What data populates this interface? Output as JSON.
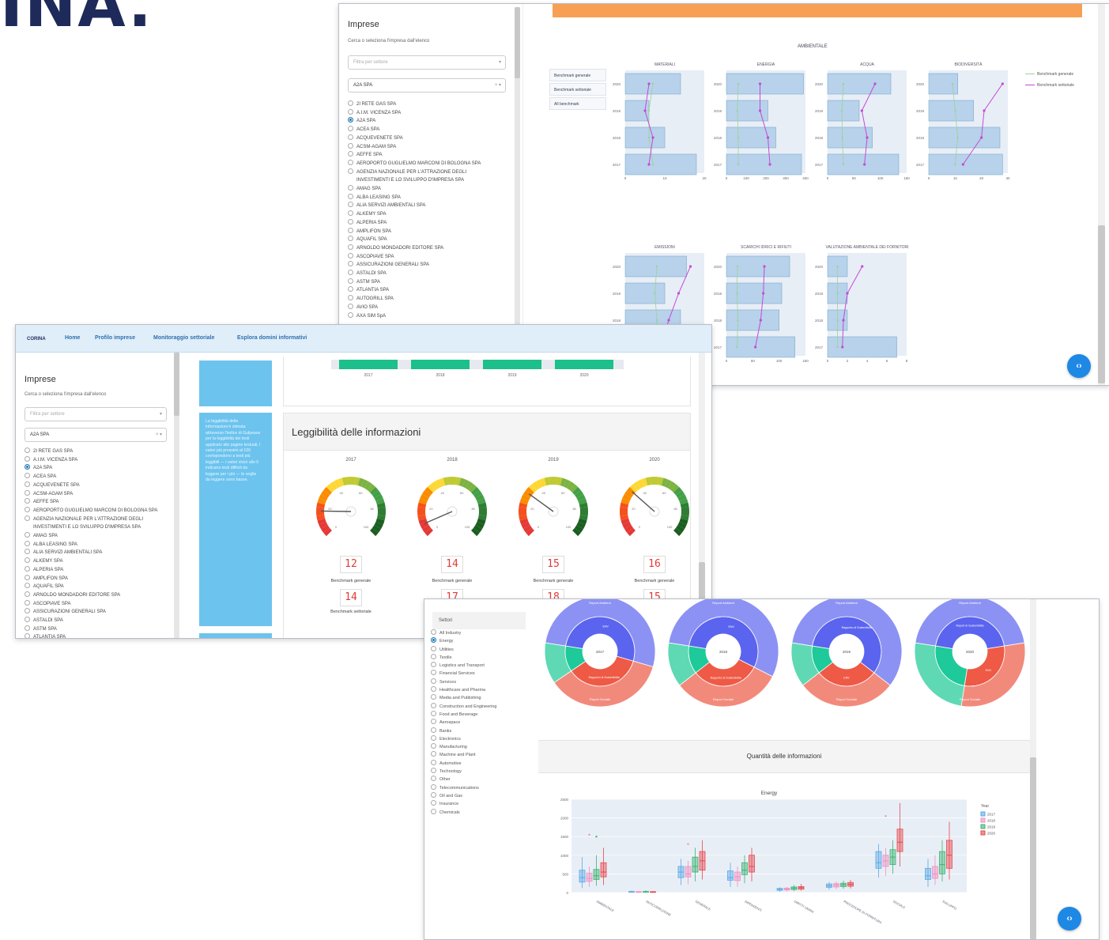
{
  "logo_text": "INA.",
  "shot1": {
    "sidebar": {
      "title": "Imprese",
      "subtitle": "Cerca o seleziona l'impresa dall'elenco",
      "filter_placeholder": "Filtra per settore",
      "selected": "A2A SPA",
      "companies": [
        "2I RETE GAS SPA",
        "A.I.M. VICENZA SPA",
        "A2A SPA",
        "ACEA SPA",
        "ACQUEVENETE SPA",
        "ACSM-AGAM SPA",
        "AEFFE SPA",
        "AEROPORTO GUGLIELMO MARCONI DI BOLOGNA SPA",
        "AGENZIA NAZIONALE PER L'ATTRAZIONE DEGLI",
        "INVESTIMENTI E LO SVILUPPO D'IMPRESA SPA",
        "AMAG SPA",
        "ALBA LEASING SPA",
        "ALIA SERVIZI AMBIENTALI SPA",
        "ALKEMY SPA",
        "ALPERIA SPA",
        "AMPLIFON SPA",
        "AQUAFIL SPA",
        "ARNOLDO MONDADORI EDITORE SPA",
        "ASCOPIAVE SPA",
        "ASSICURAZIONI GENERALI SPA",
        "ASTALDI SPA",
        "ASTM SPA",
        "ATLANTIA SPA",
        "AUTOGRILL SPA",
        "AVIO SPA",
        "AXA SIM SpA"
      ]
    },
    "benchmark_buttons": [
      "Benchmark generale",
      "Benchmark settoriale",
      "All benchmark"
    ],
    "section_title": "AMBIENTALE",
    "legend": [
      "Benchmark generale",
      "Benchmark settoriale"
    ],
    "years": [
      "2017",
      "2018",
      "2019",
      "2020"
    ],
    "top_orange_bar_color": "#f7a055",
    "panels_row1": [
      {
        "title": "MATERIALI",
        "ticks": [
          "0",
          "10",
          "20"
        ],
        "xmax": 20,
        "bars": [
          18,
          10,
          6,
          14
        ],
        "gen": [
          7,
          6,
          6,
          7
        ],
        "sect": [
          6,
          7,
          5,
          6
        ]
      },
      {
        "title": "ENERGIA",
        "ticks": [
          "0",
          "100",
          "200",
          "300",
          "400"
        ],
        "xmax": 400,
        "bars": [
          380,
          250,
          210,
          390
        ],
        "gen": [
          60,
          60,
          55,
          60
        ],
        "sect": [
          220,
          210,
          170,
          170
        ]
      },
      {
        "title": "ACQUA",
        "ticks": [
          "0",
          "50",
          "100",
          "150"
        ],
        "xmax": 150,
        "bars": [
          135,
          85,
          60,
          120
        ],
        "gen": [
          30,
          28,
          27,
          30
        ],
        "sect": [
          70,
          75,
          65,
          90
        ]
      },
      {
        "title": "BIODIVERSITÀ",
        "ticks": [
          "0",
          "10",
          "20",
          "30"
        ],
        "xmax": 30,
        "bars": [
          28,
          27,
          17,
          11
        ],
        "gen": [
          10,
          11,
          10,
          9
        ],
        "sect": [
          13,
          20,
          21,
          28
        ]
      }
    ],
    "panels_row2": [
      {
        "title": "EMISSIONI",
        "ticks": [
          "0",
          "20",
          "40"
        ],
        "xmax": 40,
        "bars": [
          35,
          28,
          20,
          31
        ],
        "gen": [
          15,
          16,
          15,
          16
        ],
        "sect": [
          18,
          22,
          27,
          33
        ]
      },
      {
        "title": "SCARICHI IDRICI E RIFIUTI",
        "ticks": [
          "0",
          "50",
          "100",
          "150"
        ],
        "xmax": 150,
        "bars": [
          130,
          100,
          105,
          120
        ],
        "gen": [
          20,
          22,
          20,
          21
        ],
        "sect": [
          55,
          65,
          70,
          72
        ]
      },
      {
        "title": "VALUTAZIONE AMBIENTALE DEI FORNITORI",
        "ticks": [
          "0",
          "2",
          "4",
          "6",
          "8"
        ],
        "xmax": 8,
        "bars": [
          7,
          2,
          2,
          2
        ],
        "gen": [
          1,
          1,
          1,
          1
        ],
        "sect": [
          1.5,
          1.6,
          2.0,
          3.5
        ]
      }
    ]
  },
  "shot2": {
    "nav": {
      "brand": "CORINA",
      "items": [
        "Home",
        "Profilo imprese",
        "Monitoraggio settoriale",
        "Esplora domini informativi"
      ]
    },
    "sidebar": {
      "title": "Imprese",
      "subtitle": "Cerca o seleziona l'impresa dall'elenco",
      "filter_placeholder": "Filtra per settore",
      "selected": "A2A SPA",
      "companies": [
        "2I RETE GAS SPA",
        "A.I.M. VICENZA SPA",
        "A2A SPA",
        "ACEA SPA",
        "ACQUEVENETE SPA",
        "ACSM-AGAM SPA",
        "AEFFE SPA",
        "AEROPORTO GUGLIELMO MARCONI DI BOLOGNA SPA",
        "AGENZIA NAZIONALE PER L'ATTRAZIONE DEGLI",
        "INVESTIMENTI E LO SVILUPPO D'IMPRESA SPA",
        "AMAG SPA",
        "ALBA LEASING SPA",
        "ALIA SERVIZI AMBIENTALI SPA",
        "ALKEMY SPA",
        "ALPERIA SPA",
        "AMPLIFON SPA",
        "AQUAFIL SPA",
        "ARNOLDO MONDADORI EDITORE SPA",
        "ASCOPIAVE SPA",
        "ASSICURAZIONI GENERALI SPA",
        "ASTALDI SPA",
        "ASTM SPA",
        "ATLANTIA SPA",
        "AUTOGRILL SPA",
        "AVIO SPA"
      ]
    },
    "top_bar_years": [
      "2017",
      "2018",
      "2019",
      "2020"
    ],
    "top_bar_color": "#1dbf8a",
    "info_text": "La leggibilità delle informazioni è stimata attraverso l'indice di Gulpease per la leggibilità dei testi applicato alle pagine testuali. I valori più prossimi al 100 corrispondono a testi più leggibili — i valori vicini allo 0 indicano testi difficili da leggere per i più — le soglie da leggere sono basse.",
    "card_title": "Leggibilità delle informazioni",
    "gauges": [
      {
        "year": "2017",
        "value": 12,
        "general": "12",
        "sectoral": "14",
        "needle": 17
      },
      {
        "year": "2018",
        "value": 14,
        "general": "14",
        "sectoral": "17",
        "needle": 8
      },
      {
        "year": "2019",
        "value": 15,
        "general": "15",
        "sectoral": "18",
        "needle": 30
      },
      {
        "year": "2020",
        "value": 16,
        "general": "16",
        "sectoral": "15",
        "needle": 32
      }
    ],
    "gauge_ticks": [
      "0",
      "20",
      "40",
      "60",
      "80",
      "100"
    ],
    "label_general": "Benchmark generale",
    "label_sectoral": "Benchmark settoriale"
  },
  "shot3": {
    "sectors_label": "Settori",
    "sectors": [
      "All Industry",
      "Energy",
      "Utilities",
      "Textile",
      "Logistics and Transport",
      "Financial Services",
      "Services",
      "Healthcare and Pharma",
      "Media and Publishing",
      "Construction and Engineering",
      "Food and Beverage",
      "Aerospace",
      "Banks",
      "Electronics",
      "Manufacturing",
      "Machine and Plant",
      "Automotive",
      "Technology",
      "Other",
      "Telecommunications",
      "Oil and Gas",
      "Insurance",
      "Chemicals"
    ],
    "selected_sector": "Energy",
    "sunbursts": [
      {
        "year": "2017",
        "inner": [
          {
            "label": "ENV",
            "v": 0.52,
            "c": "#5b64ee"
          },
          {
            "label": "Rapporto di Sostenibilità",
            "v": 0.36,
            "c": "#ee5a45"
          },
          {
            "label": "",
            "v": 0.12,
            "c": "#1ec99a"
          }
        ],
        "outer_top": "Report Ambient",
        "outer_bottom": "Report Sociale"
      },
      {
        "year": "2018",
        "inner": [
          {
            "label": "ENV",
            "v": 0.55,
            "c": "#5b64ee"
          },
          {
            "label": "Rapporto di Sostenibilità",
            "v": 0.32,
            "c": "#ee5a45"
          },
          {
            "label": "",
            "v": 0.13,
            "c": "#1ec99a"
          }
        ],
        "outer_top": "Report Ambient",
        "outer_bottom": "Report Sociale"
      },
      {
        "year": "2019",
        "inner": [
          {
            "label": "Rapporto di Sostenibilità",
            "v": 0.58,
            "c": "#5b64ee"
          },
          {
            "label": "ENV",
            "v": 0.29,
            "c": "#ee5a45"
          },
          {
            "label": "",
            "v": 0.13,
            "c": "#1ec99a"
          }
        ],
        "outer_top": "Report Ambient",
        "outer_bottom": "Report Sociale"
      },
      {
        "year": "2020",
        "inner": [
          {
            "label": "Report di Sostenibilità",
            "v": 0.45,
            "c": "#5b64ee"
          },
          {
            "label": "ENV",
            "v": 0.3,
            "c": "#ee5a45"
          },
          {
            "label": "",
            "v": 0.25,
            "c": "#1ec99a"
          }
        ],
        "outer_top": "Report Ambient",
        "outer_bottom": "Report Sociale"
      }
    ],
    "quantity_title": "Quantità delle informazioni",
    "chart_title": "Energy",
    "legend_title": "Year",
    "legend_years": [
      {
        "year": "2017",
        "color": "#5aa9e6"
      },
      {
        "year": "2018",
        "color": "#f08fc0"
      },
      {
        "year": "2019",
        "color": "#3cb371"
      },
      {
        "year": "2020",
        "color": "#e8474c"
      }
    ],
    "y_ticks": [
      "0",
      "500",
      "1000",
      "1500",
      "2000",
      "2500"
    ],
    "fab_label": "‹›"
  },
  "chart_data": {
    "type": "box",
    "title": "Energy",
    "legend_title": "Year",
    "series_names": [
      "2017",
      "2018",
      "2019",
      "2020"
    ],
    "categories": [
      "AMBIENTALE",
      "ANTICORRUZIONE",
      "GENERALE",
      "DIPENDENTI",
      "DIRITTI UMANI",
      "PROCEDURE DI FORNITURA",
      "SOCIALE",
      "SVILUPPO"
    ],
    "ylim": [
      0,
      2500
    ],
    "boxes": [
      [
        [
          120,
          280,
          400,
          600,
          950
        ],
        [
          150,
          300,
          380,
          520,
          700
        ],
        [
          180,
          350,
          450,
          620,
          1000
        ],
        [
          200,
          420,
          550,
          800,
          1200
        ]
      ],
      [
        [
          0,
          10,
          20,
          30,
          50
        ],
        [
          0,
          10,
          15,
          25,
          40
        ],
        [
          0,
          10,
          20,
          30,
          60
        ],
        [
          0,
          10,
          15,
          25,
          40
        ]
      ],
      [
        [
          200,
          400,
          550,
          700,
          900
        ],
        [
          220,
          420,
          500,
          700,
          850
        ],
        [
          300,
          550,
          700,
          950,
          1200
        ],
        [
          350,
          600,
          850,
          1100,
          1400
        ]
      ],
      [
        [
          150,
          330,
          400,
          580,
          800
        ],
        [
          160,
          320,
          420,
          550,
          700
        ],
        [
          250,
          480,
          600,
          800,
          1000
        ],
        [
          300,
          550,
          700,
          1000,
          1200
        ]
      ],
      [
        [
          20,
          60,
          90,
          110,
          140
        ],
        [
          30,
          70,
          90,
          120,
          150
        ],
        [
          40,
          80,
          120,
          150,
          200
        ],
        [
          50,
          90,
          130,
          160,
          230
        ]
      ],
      [
        [
          80,
          140,
          180,
          230,
          280
        ],
        [
          90,
          150,
          200,
          240,
          300
        ],
        [
          100,
          160,
          210,
          250,
          320
        ],
        [
          110,
          170,
          220,
          270,
          340
        ]
      ],
      [
        [
          400,
          650,
          800,
          1100,
          1300
        ],
        [
          450,
          700,
          850,
          1000,
          1200
        ],
        [
          500,
          750,
          950,
          1150,
          1400
        ],
        [
          700,
          1100,
          1350,
          1700,
          2400
        ]
      ],
      [
        [
          150,
          350,
          450,
          650,
          900
        ],
        [
          200,
          380,
          500,
          700,
          1000
        ],
        [
          300,
          500,
          750,
          1100,
          1400
        ],
        [
          350,
          650,
          1000,
          1400,
          1900
        ]
      ]
    ],
    "outliers": [
      [
        1550,
        1500
      ],
      [],
      [
        1300
      ],
      [],
      [],
      [],
      [
        2050
      ],
      []
    ]
  }
}
